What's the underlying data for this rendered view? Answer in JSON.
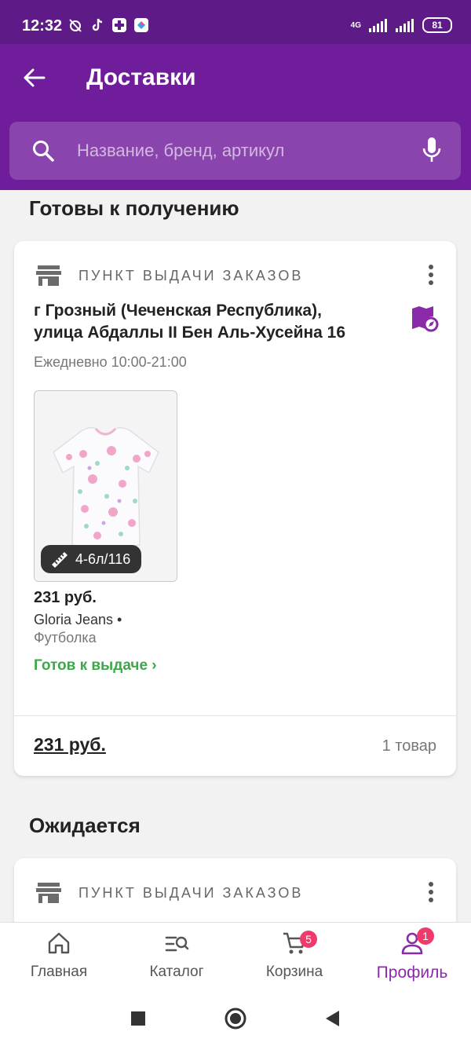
{
  "status_bar": {
    "time": "12:32",
    "network": "4G",
    "battery": "81",
    "icons": [
      "alarm-off-icon",
      "tiktok-icon",
      "app-icon",
      "app-icon"
    ]
  },
  "header": {
    "title": "Доставки",
    "search_placeholder": "Название, бренд, артикул",
    "bg_color": "#6f1d9b"
  },
  "sections": [
    {
      "title": "Готовы к получению",
      "pickup_label": "ПУНКТ ВЫДАЧИ ЗАКАЗОВ",
      "address_line1": "г Грозный (Чеченская Республика),",
      "address_line2": "улица Абдаллы II Бен Аль-Хусейна 16",
      "hours": "Ежедневно 10:00-21:00",
      "product": {
        "size": "4-6л/116",
        "price": "231 руб.",
        "brand": "Gloria Jeans •",
        "type": "Футболка",
        "status": "Готов к выдаче ›"
      },
      "total": "231 руб.",
      "items_count": "1 товар"
    },
    {
      "title": "Ожидается",
      "pickup_label": "ПУНКТ ВЫДАЧИ ЗАКАЗОВ"
    }
  ],
  "bottom_nav": {
    "items": [
      {
        "label": "Главная",
        "icon": "home-icon"
      },
      {
        "label": "Каталог",
        "icon": "catalog-icon"
      },
      {
        "label": "Корзина",
        "icon": "cart-icon",
        "badge": "5"
      },
      {
        "label": "Профиль",
        "icon": "profile-icon",
        "badge": "1"
      }
    ],
    "active_color": "#8a2aa8",
    "badge_color": "#ef3b6c"
  },
  "status_ready_color": "#3da84a"
}
